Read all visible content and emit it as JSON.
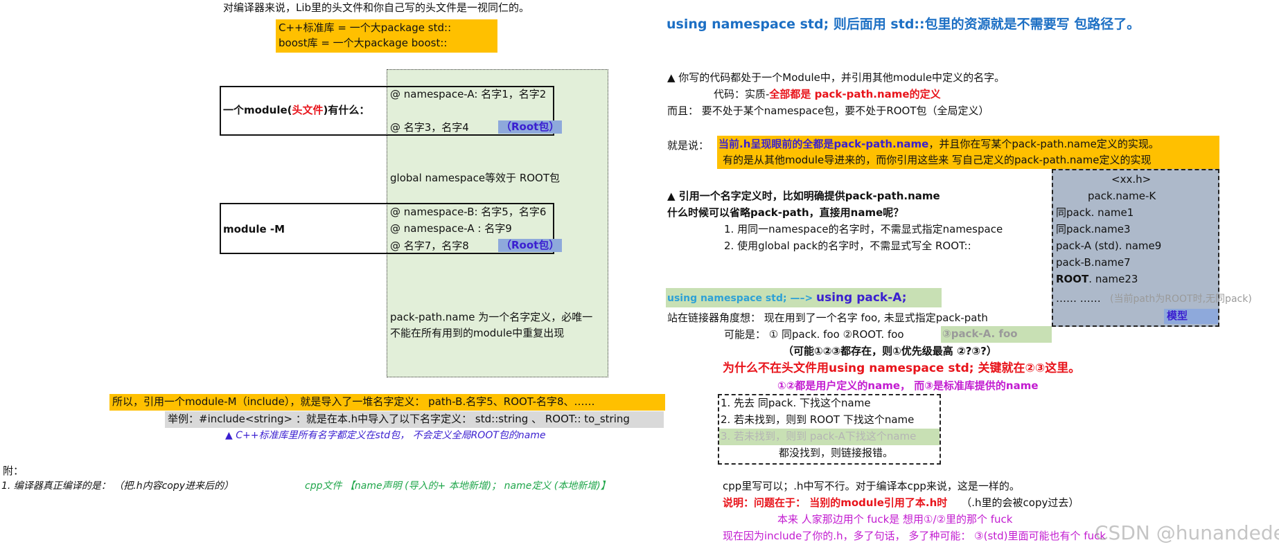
{
  "left": {
    "intro": "对编译器来说，Lib里的头文件和你自己写的头文件是一视同仁的。",
    "std_pkg": "C++标准库 = 一个大package std::",
    "boost_pkg": "boost库 = 一个大package  boost::",
    "module1": {
      "label_pre": "一个module(",
      "label_red": "头文件",
      "label_post": ")有什么：",
      "ns_line": "@  namespace-A: 名字1，名字2",
      "root_line": "@  名字3，名字4",
      "root_tag": "（Root包）"
    },
    "global_ns": "global namespace等效于 ROOT包",
    "module2": {
      "label": "module -M",
      "ns_b": "@  namespace-B: 名字5，名字6",
      "ns_a": "@ namespace-A : 名字9",
      "root_line": "@  名字7，名字8",
      "root_tag": "（Root包）"
    },
    "pack_def_1": "pack-path.name 为一个名字定义，必唯一",
    "pack_def_2": "不能在所有用到的module中重复出现",
    "include_line": "所以，引用一个module-M（include），就是导入了一堆名字定义： path-B.名字5、ROOT-名字8、……",
    "example_line": "举例：#include<string> ：就是在本.h中导入了以下名字定义： std::string 、 ROOT:: to_string",
    "std_note": "▲  C++标准库里所有名字都定义在std包，  不会定义全局ROOT包的name",
    "appendix_title": "附：",
    "appendix_1": "1.  编译器真正编译的是：  （把.h内容copy进来后的）",
    "appendix_2": "cpp文件 【name声明 (导入的+ 本地新增)；  name定义 (本地新增)】"
  },
  "right": {
    "headline": "using namespace std;   则后面用 std::包里的资源就是不需要写 包路径了。",
    "p1": "▲ 你写的代码都处于一个Module中，并引用其他module中定义的名字。",
    "p2_pre": "代码：实质-",
    "p2_red": "全部都是 pack-path.name的定义",
    "p3": "而且：  要不处于某个namespace包，要不处于ROOT包（全局定义）",
    "p4_label": "就是说：",
    "p4_a": "当前.h呈现眼前的全都是pack-path.name",
    "p4_b": "，并且你在写某个pack-path.name定义的实现。",
    "p4_c": "有的是从其他module导进来的，而你引用这些来 写自己定义的pack-path.name定义的实现",
    "q1": "▲  引用一个名字定义时，比如明确提供pack-path.name",
    "q2": "什么时候可以省略pack-path，直接用name呢？",
    "q3": "1.  用同一namespace的名字时，不需显式指定namespace",
    "q4": "2.  使用global  pack的名字时，不需显式写全 ROOT::",
    "model": {
      "header": "<xx.h>",
      "sub": "pack.name-K",
      "r1": "同pack. name1",
      "r2": "同pack.name3",
      "r3": "pack-A (std). name9",
      "r4": "pack-B.name7",
      "r5_bold": "ROOT",
      "r5_rest": ". name23",
      "r6": "…… ……",
      "r6_note": "(当前path为ROOT时,无同pack)",
      "tag": "模型"
    },
    "using_bar_a": "using namespace std;  —–>",
    "using_bar_b": "using pack-A;",
    "linker_1": "站在链接器角度想：   现在用到了一个名字 foo, 未显式指定pack-path",
    "linker_2a": "可能是：  ① 同pack. foo   ②ROOT. foo",
    "linker_2b": "③pack-A. foo",
    "linker_3": "（可能①②③都存在，则①优先级最高 ②?③?）",
    "why": "为什么不在头文件用using namespace std; 关键就在②③这里。",
    "why_sub": "①②都是用户定义的name，  而③是标准库提供的name",
    "steps": {
      "s1": "1. 先去 同pack. 下找这个name",
      "s2": "2. 若未找到，则到 ROOT 下找这个name",
      "s3": "3. 若未找到，则到 pack-A下找这个name",
      "s4": "都没找到，则链接报错。"
    },
    "cpp_ok": "cpp里写可以；.h中写不行。对于编译本cpp来说，这是一样的。",
    "expl_red": "说明：问题在于：  当别的module引用了本.h时",
    "expl_rest": "（.h里的会被copy过去）",
    "expl_2": "本来 人家那边用个 fuck是 想用①/②里的那个 fuck",
    "expl_3": "现在因为include了你的.h，多了句话，  多了种可能：  ③(std)里面可能也有个 fuck",
    "watermark": "CSDN @hunandede"
  }
}
